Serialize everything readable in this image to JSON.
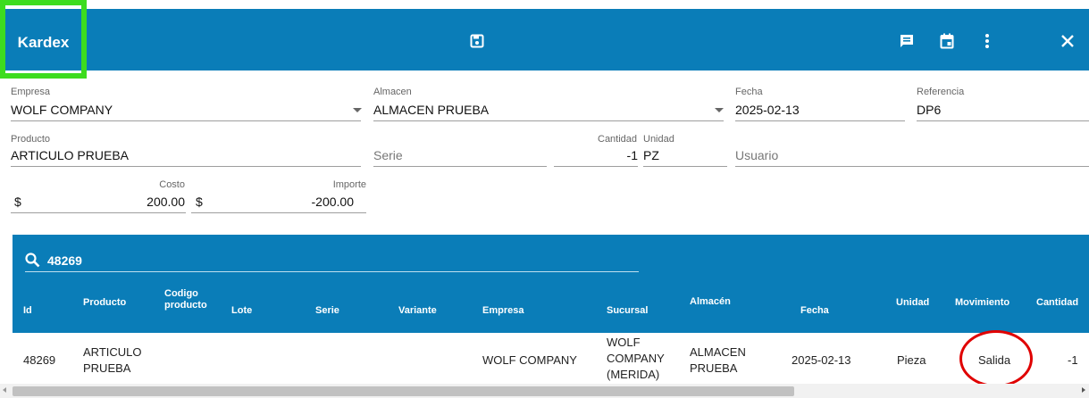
{
  "header": {
    "title": "Kardex",
    "icons": [
      "save-icon",
      "message-icon",
      "calendar-icon",
      "more-vert-icon",
      "close-icon"
    ]
  },
  "form": {
    "empresa_label": "Empresa",
    "empresa_value": "WOLF COMPANY",
    "almacen_label": "Almacen",
    "almacen_value": "ALMACEN PRUEBA",
    "fecha_label": "Fecha",
    "fecha_value": "2025-02-13",
    "referencia_label": "Referencia",
    "referencia_value": "DP6",
    "producto_label": "Producto",
    "producto_value": "ARTICULO PRUEBA",
    "serie_placeholder": "Serie",
    "cantidad_label": "Cantidad",
    "cantidad_value": "-1",
    "unidad_label": "Unidad",
    "unidad_value": "PZ",
    "usuario_placeholder": "Usuario",
    "costo_label": "Costo",
    "costo_prefix": "$",
    "costo_value": "200.00",
    "importe_label": "Importe",
    "importe_prefix": "$",
    "importe_value": "-200.00"
  },
  "table": {
    "search_value": "48269",
    "columns": [
      "Id",
      "Producto",
      "Codigo producto",
      "Lote",
      "Serie",
      "Variante",
      "Empresa",
      "Sucursal",
      "Almacén",
      "Fecha",
      "Unidad",
      "Movimiento",
      "Cantidad"
    ],
    "rows": [
      {
        "id": "48269",
        "producto": "ARTICULO PRUEBA",
        "codigo": "",
        "lote": "",
        "serie": "",
        "variante": "",
        "empresa": "WOLF COMPANY",
        "sucursal": "WOLF COMPANY (MERIDA)",
        "almacen": "ALMACEN PRUEBA",
        "fecha": "2025-02-13",
        "unidad": "Pieza",
        "movimiento": "Salida",
        "cantidad": "-1"
      }
    ]
  },
  "colors": {
    "primary": "#0a7db8",
    "highlight_box": "#3ddc1f",
    "annotation_circle": "#e00000"
  }
}
